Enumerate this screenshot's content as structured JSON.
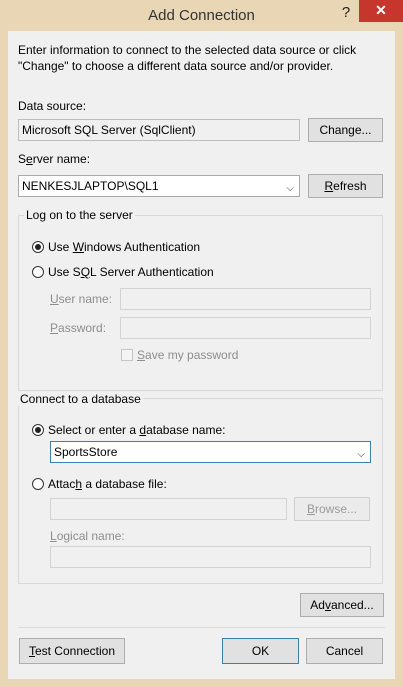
{
  "window": {
    "title": "Add Connection",
    "help": "?",
    "close": "✕"
  },
  "intro": {
    "line1": "Enter information to connect to the selected data source or click",
    "line2": "\"Change\" to choose a different data source and/or provider."
  },
  "data_source": {
    "label": "Data source:",
    "value": "Microsoft SQL Server (SqlClient)",
    "change_button": "Change..."
  },
  "server": {
    "label_pre": "S",
    "label_u": "e",
    "label_post": "rver name:",
    "value": "NENKESJLAPTOP\\SQL1",
    "refresh_pre": "",
    "refresh_u": "R",
    "refresh_post": "efresh"
  },
  "logon": {
    "title": "Log on to the server",
    "windows_auth": {
      "pre": "Use ",
      "u": "W",
      "post": "indows Authentication",
      "selected": true
    },
    "sql_auth": {
      "pre": "Use S",
      "u": "Q",
      "post": "L Server Authentication",
      "selected": false
    },
    "user_name": {
      "pre": "",
      "u": "U",
      "post": "ser name:",
      "value": ""
    },
    "password": {
      "pre": "",
      "u": "P",
      "post": "assword:",
      "value": ""
    },
    "save_password": {
      "pre": "",
      "u": "S",
      "post": "ave my password",
      "checked": false
    }
  },
  "database": {
    "title": "Connect to a database",
    "select_name": {
      "pre": "Select or enter a ",
      "u": "d",
      "post": "atabase name:",
      "selected": true
    },
    "db_value": "SportsStore",
    "attach_file": {
      "pre": "Attac",
      "u": "h",
      "post": " a database file:",
      "selected": false
    },
    "file_value": "",
    "browse": {
      "pre": "",
      "u": "B",
      "post": "rowse..."
    },
    "logical_name": {
      "pre": "",
      "u": "L",
      "post": "ogical name:",
      "value": ""
    }
  },
  "advanced": {
    "pre": "Ad",
    "u": "v",
    "post": "anced..."
  },
  "footer": {
    "test": {
      "pre": "",
      "u": "T",
      "post": "est Connection"
    },
    "ok": "OK",
    "cancel": "Cancel"
  }
}
